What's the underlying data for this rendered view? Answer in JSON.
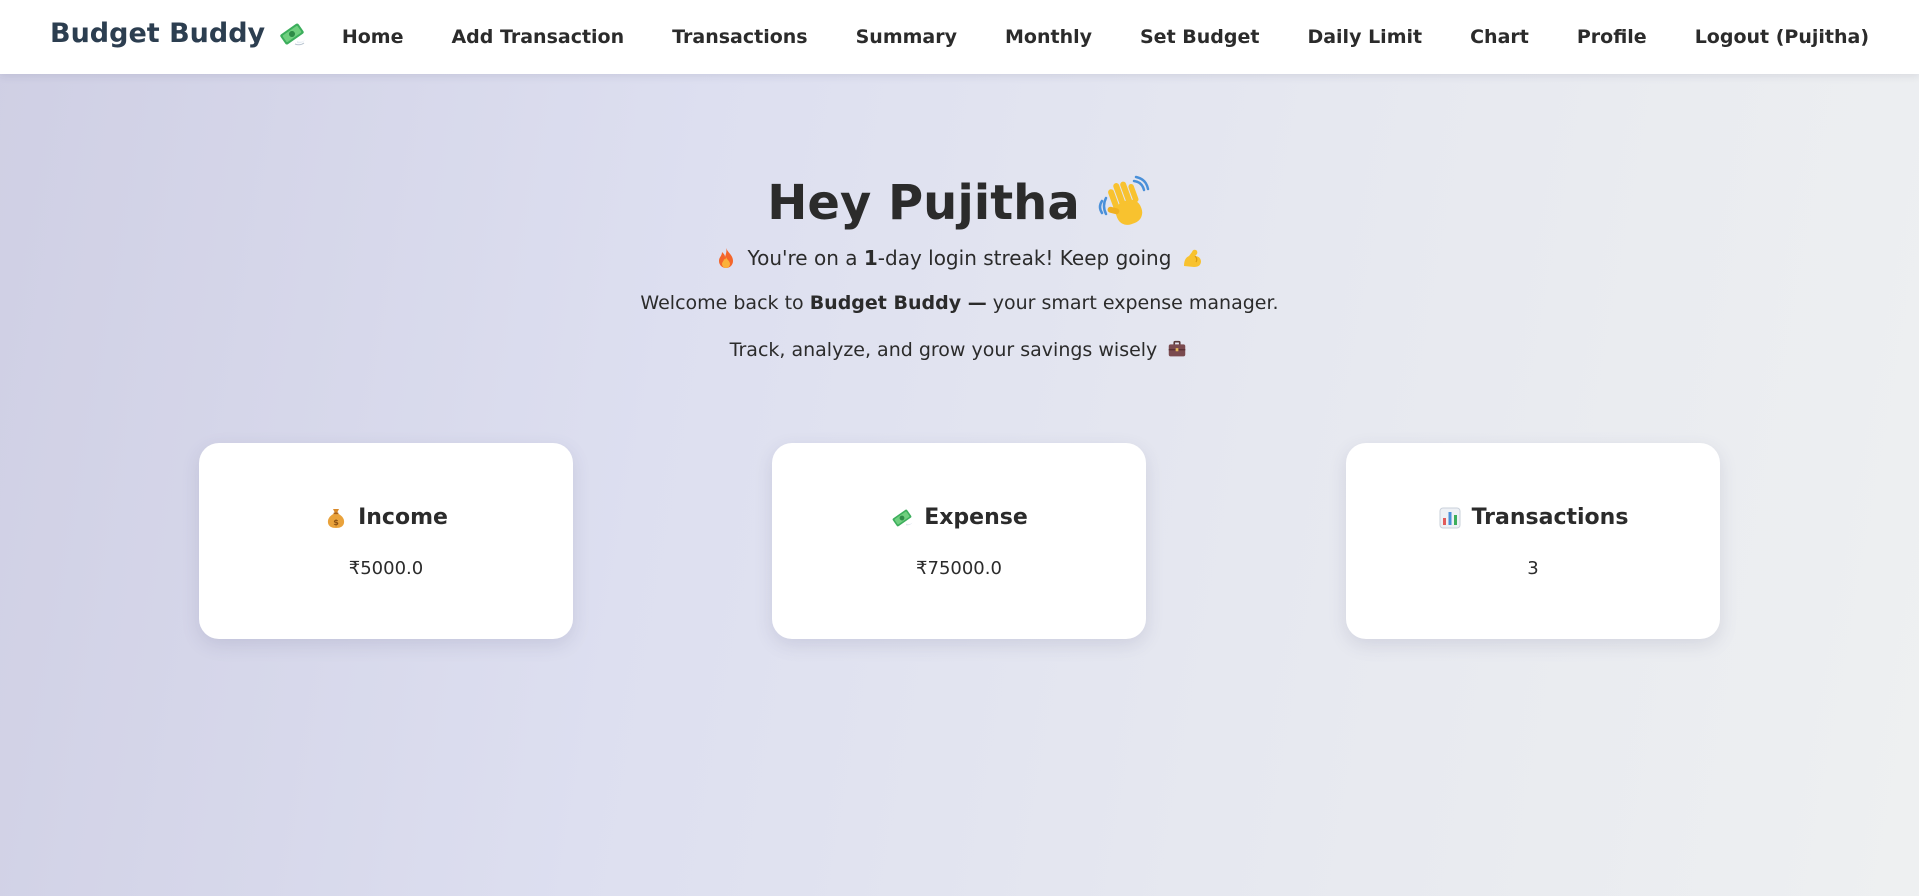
{
  "brand": {
    "name": "Budget Buddy",
    "icon": "money-with-wings-icon"
  },
  "nav": {
    "items": [
      {
        "label": "Home"
      },
      {
        "label": "Add Transaction"
      },
      {
        "label": "Transactions"
      },
      {
        "label": "Summary"
      },
      {
        "label": "Monthly"
      },
      {
        "label": "Set Budget"
      },
      {
        "label": "Daily Limit"
      },
      {
        "label": "Chart"
      },
      {
        "label": "Profile"
      },
      {
        "label": "Logout (Pujitha)"
      }
    ]
  },
  "hero": {
    "greeting": "Hey Pujitha",
    "greeting_icon": "waving-hand-icon",
    "streak_prefix": "You're on a",
    "streak_days": "1",
    "streak_suffix": "-day login streak! Keep going",
    "streak_icons": [
      "fire-icon",
      "flexed-biceps-icon"
    ],
    "welcome_prefix": "Welcome back to",
    "welcome_brand": "Budget Buddy —",
    "welcome_suffix": "your smart expense manager.",
    "tagline": "Track, analyze, and grow your savings wisely",
    "tagline_icon": "briefcase-icon"
  },
  "cards": {
    "income": {
      "title": "Income",
      "value": "₹5000.0",
      "icon": "money-bag-icon"
    },
    "expense": {
      "title": "Expense",
      "value": "₹75000.0",
      "icon": "money-with-wings-icon"
    },
    "transactions": {
      "title": "Transactions",
      "value": "3",
      "icon": "bar-chart-icon"
    }
  },
  "colors": {
    "brand_text": "#2c3e50",
    "text": "#2b2b2b",
    "card_bg": "#ffffff",
    "navbar_bg": "#ffffff"
  }
}
